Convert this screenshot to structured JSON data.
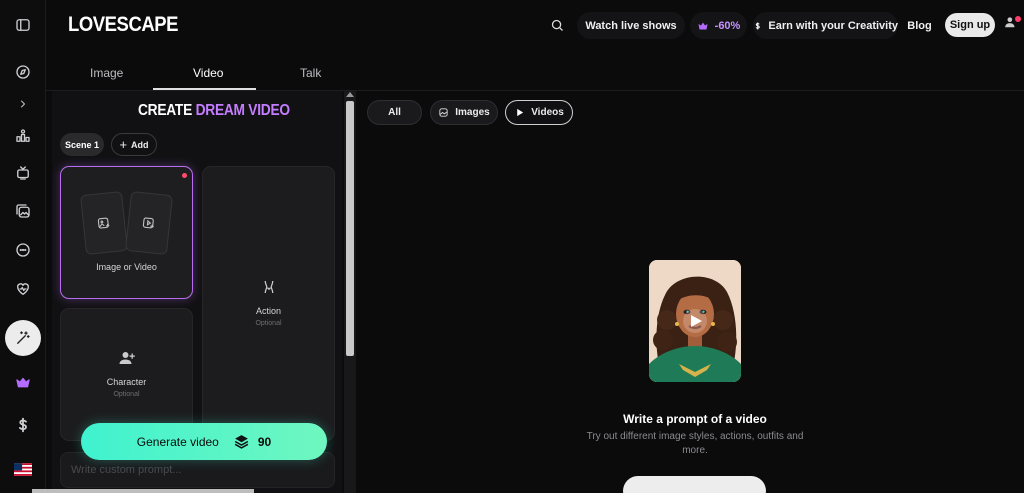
{
  "brand": {
    "logo": "LOVESCAPE"
  },
  "header": {
    "watch_live": "Watch live shows",
    "discount": "-60%",
    "earn": "Earn with your Creativity",
    "blog": "Blog",
    "signup": "Sign up"
  },
  "tabs": [
    {
      "label": "Image",
      "selected": false
    },
    {
      "label": "Video",
      "selected": true
    },
    {
      "label": "Talk",
      "selected": false
    }
  ],
  "panel": {
    "title_white": "CREATE",
    "title_purple": "DREAM VIDEO",
    "scene": "Scene 1",
    "add": "Add",
    "cards": {
      "image_or_video": "Image or Video",
      "action": "Action",
      "action_sub": "Optional",
      "character": "Character",
      "character_sub": "Optional"
    },
    "generate": "Generate video",
    "credits": "90",
    "prompt_placeholder": "Write custom prompt..."
  },
  "filters": [
    {
      "label": "All",
      "selected": false
    },
    {
      "label": "Images",
      "selected": false
    },
    {
      "label": "Videos",
      "selected": true
    }
  ],
  "empty_state": {
    "title": "Write a prompt of a video",
    "subtitle": "Try out different image styles, actions, outfits and more."
  },
  "colors": {
    "accent_purple": "#c57dff",
    "accent_teal": "#3ff2cf",
    "discount_purple": "#b46cff"
  },
  "rail_icons": [
    "compass-icon",
    "chevron-right-icon",
    "leaderboard-icon",
    "tv-icon",
    "gallery-icon",
    "chat-icon",
    "heart-icon",
    "magic-wand-icon",
    "crown-icon",
    "dollar-icon",
    "us-flag-icon"
  ]
}
